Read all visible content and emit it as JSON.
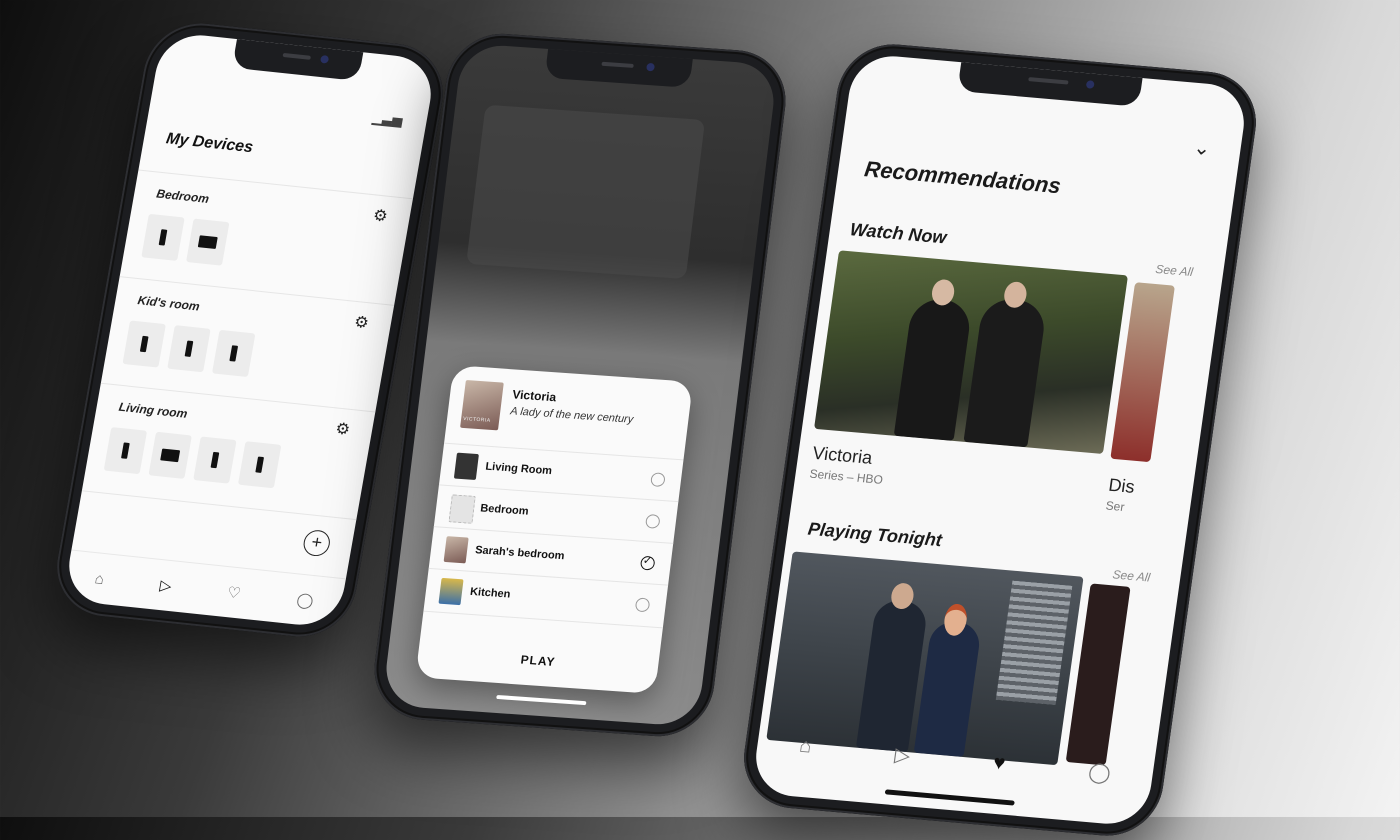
{
  "phone1": {
    "title": "My Devices",
    "stats_icon": "bar-chart-icon",
    "rooms": [
      {
        "name": "Bedroom"
      },
      {
        "name": "Kid's room"
      },
      {
        "name": "Living room"
      }
    ],
    "add_icon": "+",
    "nav": [
      "home-icon",
      "play-icon",
      "heart-icon",
      "user-icon"
    ]
  },
  "phone2": {
    "poster_text": "VICTORIA",
    "title": "Victoria",
    "subtitle": "A lady of the new century",
    "rooms": [
      {
        "name": "Living Room",
        "selected": false
      },
      {
        "name": "Bedroom",
        "selected": false
      },
      {
        "name": "Sarah's bedroom",
        "selected": true
      },
      {
        "name": "Kitchen",
        "selected": false
      }
    ],
    "play_label": "PLAY"
  },
  "phone3": {
    "title": "Recommendations",
    "watch_now": {
      "heading": "Watch Now",
      "see_all": "See All",
      "items": [
        {
          "title": "Victoria",
          "subtitle": "Series – HBO"
        },
        {
          "title": "Dis",
          "subtitle": "Ser"
        }
      ]
    },
    "playing_tonight": {
      "heading": "Playing Tonight",
      "see_all": "See All"
    },
    "nav": [
      "home-icon",
      "play-icon",
      "heart-icon",
      "user-icon"
    ],
    "active_nav": "heart-icon"
  }
}
